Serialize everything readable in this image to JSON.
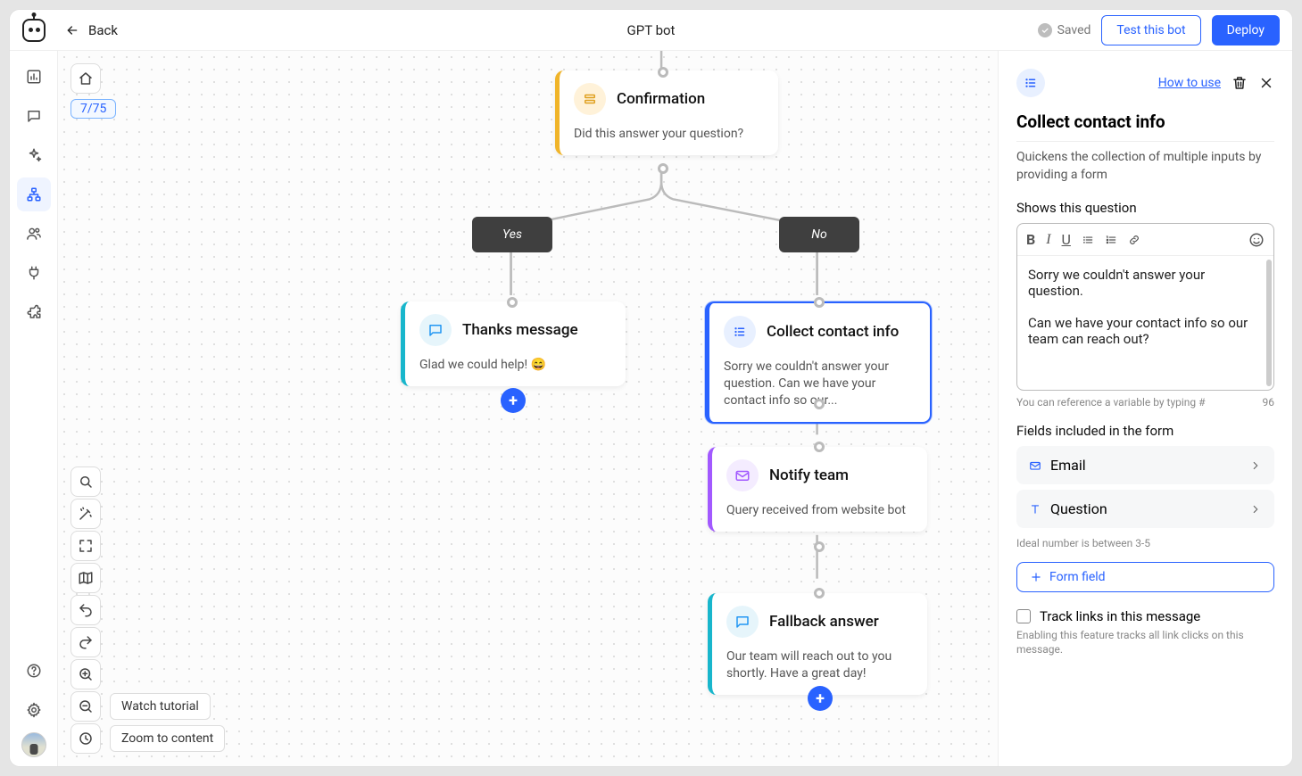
{
  "app": {
    "logo_alt": "bot-logo"
  },
  "topbar": {
    "back_label": "Back",
    "title": "GPT bot",
    "saved_label": "Saved",
    "test_button": "Test this bot",
    "deploy_button": "Deploy"
  },
  "sidebar": {
    "items": [
      "analytics",
      "conversations",
      "ai",
      "flow",
      "contacts",
      "integrations",
      "extensions"
    ],
    "active": "flow"
  },
  "canvas": {
    "home_icon": "home",
    "node_count": "7/75",
    "tools": [
      "search",
      "magic",
      "expand",
      "map",
      "undo",
      "redo",
      "help",
      "zoom-in",
      "zoom-out",
      "recent"
    ],
    "labels": {
      "watch_tutorial": "Watch tutorial",
      "zoom_to_content": "Zoom to content"
    }
  },
  "flow": {
    "confirmation": {
      "title": "Confirmation",
      "body": "Did this answer your question?"
    },
    "yes": "Yes",
    "no": "No",
    "thanks": {
      "title": "Thanks message",
      "body": "Glad we could help! 😄"
    },
    "collect": {
      "title": "Collect contact info",
      "body": "Sorry we couldn't answer your question. Can we have your contact info so our..."
    },
    "notify": {
      "title": "Notify team",
      "body": "Query received from website bot"
    },
    "fallback": {
      "title": "Fallback answer",
      "body": "Our team will reach out to you shortly. Have a great day!"
    }
  },
  "panel": {
    "how_to_use": "How to use",
    "title": "Collect contact info",
    "description": "Quickens the collection of multiple inputs by providing a form",
    "question_label": "Shows this question",
    "question_text": "Sorry we couldn't answer your question.\n\nCan we have your contact info so our team can reach out?",
    "var_hint": "You can reference a variable by typing #",
    "char_count": "96",
    "fields_label": "Fields included in the form",
    "fields": [
      {
        "label": "Email",
        "icon": "mail"
      },
      {
        "label": "Question",
        "icon": "text"
      }
    ],
    "ideal_hint": "Ideal number is between 3-5",
    "add_field": "Form field",
    "track_label": "Track links in this message",
    "track_help": "Enabling this feature tracks all link clicks on this message."
  }
}
